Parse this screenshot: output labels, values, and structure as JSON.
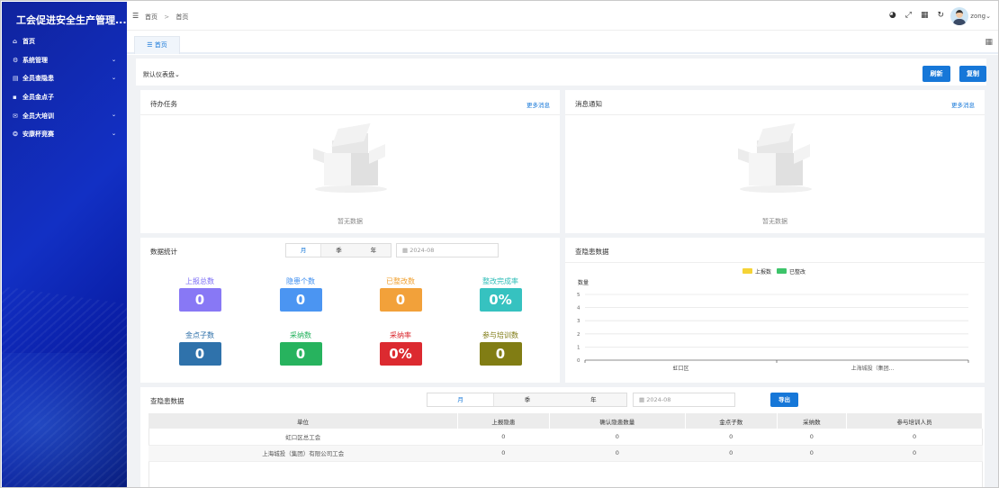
{
  "app": {
    "title": "工会促进安全生产管理..."
  },
  "sidebar": {
    "items": [
      {
        "label": "首页",
        "icon": "home-icon",
        "glyph": "⌂",
        "has_children": false
      },
      {
        "label": "系统管理",
        "icon": "gear-icon",
        "glyph": "⚙",
        "has_children": true
      },
      {
        "label": "全员查隐患",
        "icon": "report-icon",
        "glyph": "▤",
        "has_children": true
      },
      {
        "label": "全员金点子",
        "icon": "bulb-icon",
        "glyph": "▪",
        "has_children": false
      },
      {
        "label": "全员大培训",
        "icon": "training-icon",
        "glyph": "✉",
        "has_children": true
      },
      {
        "label": "安康杯竞赛",
        "icon": "cup-icon",
        "glyph": "❂",
        "has_children": true
      }
    ]
  },
  "topbar": {
    "breadcrumb": [
      "首页",
      "首页"
    ],
    "breadcrumb_sep": ">",
    "user": "zong"
  },
  "tabs": [
    {
      "label": "首页",
      "active": true
    }
  ],
  "dashboard": {
    "selector": "默认仪表盘",
    "refresh_label": "刷新",
    "copy_label": "复制"
  },
  "todo": {
    "title": "待办任务",
    "more": "更多消息",
    "empty": "暂无数据"
  },
  "notice": {
    "title": "消息通知",
    "more": "更多消息",
    "empty": "暂无数据"
  },
  "stats": {
    "title": "数据统计",
    "periods": [
      "月",
      "季",
      "年"
    ],
    "active_period": "月",
    "date": "2024-08",
    "items": [
      {
        "label": "上报总数",
        "value": "0",
        "label_color": "#7b6cf6",
        "bg": "#8878f5"
      },
      {
        "label": "隐患个数",
        "value": "0",
        "label_color": "#3d8ef0",
        "bg": "#4b95f2"
      },
      {
        "label": "已整改数",
        "value": "0",
        "label_color": "#f0a030",
        "bg": "#f2a13a"
      },
      {
        "label": "整改完成率",
        "value": "0%",
        "label_color": "#2fbdb8",
        "bg": "#36c2c0"
      },
      {
        "label": "金点子数",
        "value": "0",
        "label_color": "#2c6fa8",
        "bg": "#2f72ab"
      },
      {
        "label": "采纳数",
        "value": "0",
        "label_color": "#22b05a",
        "bg": "#27b35e"
      },
      {
        "label": "采纳率",
        "value": "0%",
        "label_color": "#d9252b",
        "bg": "#dc2a30"
      },
      {
        "label": "参与培训数",
        "value": "0",
        "label_color": "#7e7a12",
        "bg": "#817d14"
      }
    ]
  },
  "hazard_chart": {
    "title": "查隐患数据"
  },
  "chart_data": {
    "type": "bar",
    "title": "",
    "ylabel": "数量",
    "xlabel": "",
    "categories": [
      "虹口区",
      "上海城投（集团..."
    ],
    "series": [
      {
        "name": "上报数",
        "color": "#f5d336",
        "values": [
          0,
          0
        ]
      },
      {
        "name": "已整改",
        "color": "#3dc46a",
        "values": [
          0,
          0
        ]
      }
    ],
    "ylim": [
      0,
      5
    ],
    "yticks": [
      "0",
      "1",
      "2",
      "3",
      "4",
      "5"
    ],
    "grid": true,
    "legend": "top-center"
  },
  "hazard_table": {
    "title": "查隐患数据",
    "periods": [
      "月",
      "季",
      "年"
    ],
    "active_period": "月",
    "date": "2024-08",
    "export_label": "导出",
    "columns": [
      "单位",
      "上报隐患",
      "确认隐患数量",
      "金点子数",
      "采纳数",
      "参与培训人员"
    ],
    "rows": [
      [
        "虹口区总工会",
        "0",
        "0",
        "0",
        "0",
        "0"
      ],
      [
        "上海城投（集团）有限公司工会",
        "0",
        "0",
        "0",
        "0",
        "0"
      ]
    ]
  }
}
